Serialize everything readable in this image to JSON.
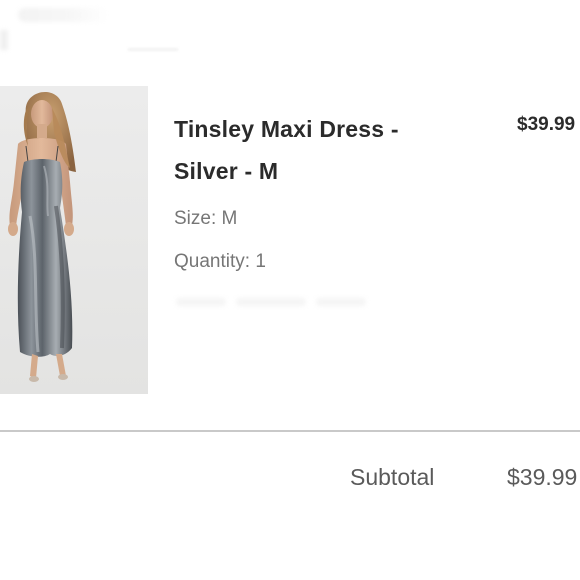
{
  "cart_item": {
    "title_line1": "Tinsley Maxi Dress -",
    "title_line2": "Silver - M",
    "price": "$39.99",
    "size": "Size: M",
    "quantity": "Quantity: 1",
    "image_icon": "product-photo-silver-maxi-dress"
  },
  "summary": {
    "subtotal_label": "Subtotal",
    "subtotal_value": "$39.99"
  },
  "colors": {
    "text_dark": "#2b2b2b",
    "text_muted": "#767676",
    "divider": "#c9c9c9",
    "background": "#ffffff"
  }
}
